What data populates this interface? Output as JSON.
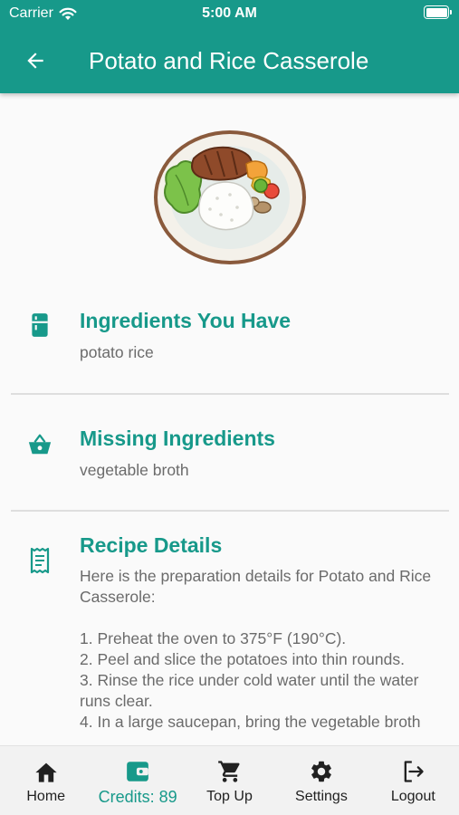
{
  "status_bar": {
    "carrier": "Carrier",
    "time": "5:00 AM"
  },
  "header": {
    "title": "Potato and Rice Casserole",
    "back_icon": "arrow-left-icon"
  },
  "sections": {
    "have": {
      "icon": "fridge-icon",
      "title": "Ingredients You Have",
      "body": "potato rice"
    },
    "missing": {
      "icon": "basket-icon",
      "title": "Missing Ingredients",
      "body": "vegetable broth"
    },
    "recipe": {
      "icon": "receipt-icon",
      "title": "Recipe Details",
      "body": "Here is the preparation details for Potato and Rice Casserole:\n\n1. Preheat the oven to 375°F (190°C).\n2. Peel and slice the potatoes into thin rounds.\n3. Rinse the rice under cold water until the water runs clear.\n4. In a large saucepan, bring the vegetable broth"
    }
  },
  "bottom_nav": {
    "items": [
      {
        "label": "Home",
        "icon": "home-icon"
      },
      {
        "label": "Credits: 89",
        "icon": "wallet-icon",
        "active": true
      },
      {
        "label": "Top Up",
        "icon": "cart-icon"
      },
      {
        "label": "Settings",
        "icon": "gear-icon"
      },
      {
        "label": "Logout",
        "icon": "logout-icon"
      }
    ]
  },
  "colors": {
    "primary": "#17998a",
    "text_secondary": "#6b6b6b",
    "background": "#fafafa"
  }
}
